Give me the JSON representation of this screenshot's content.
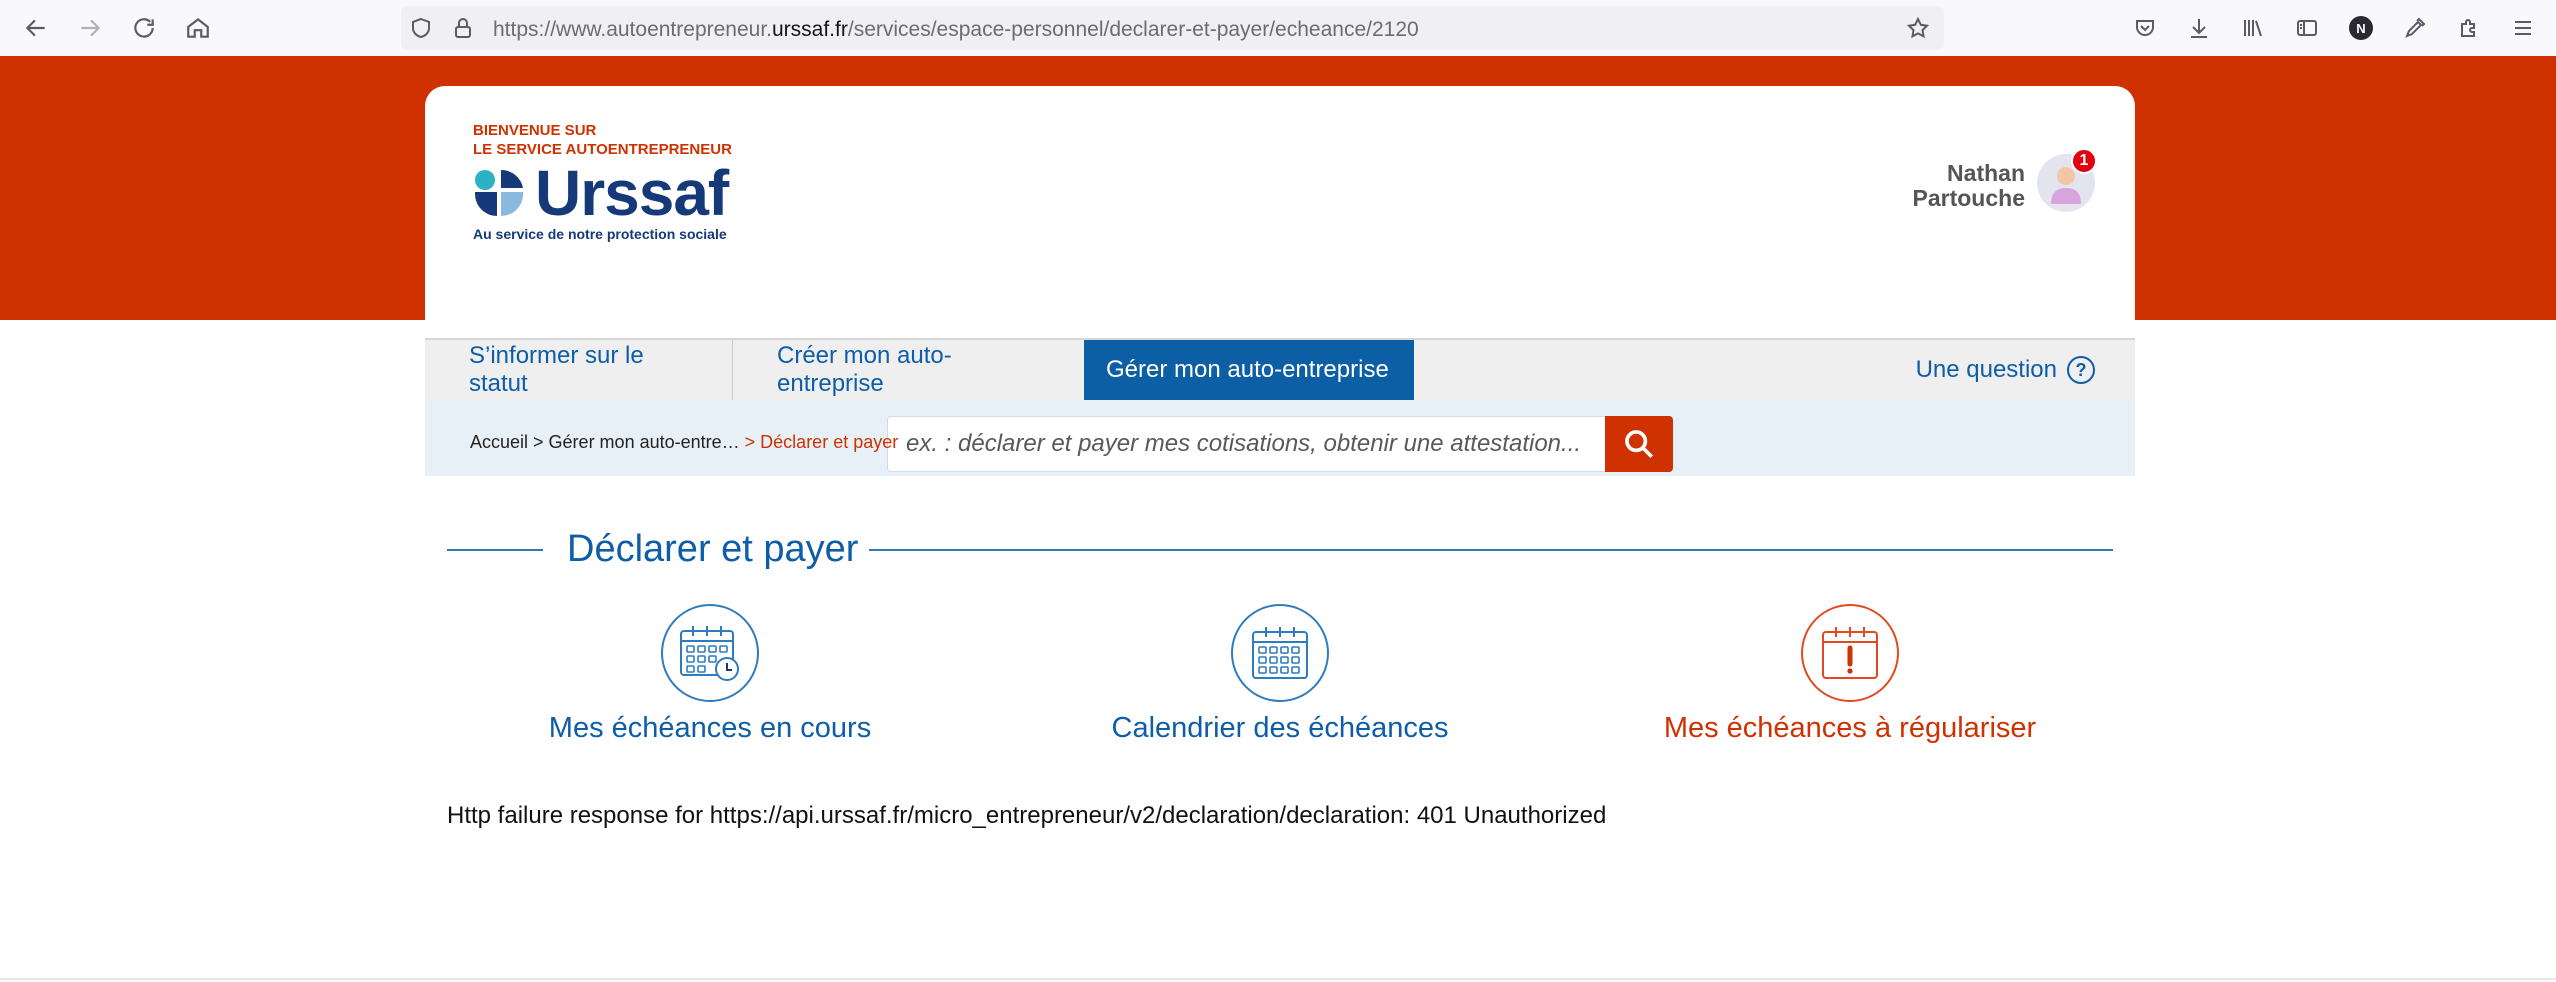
{
  "browser": {
    "url_prefix": "https://www.autoentrepreneur.",
    "url_domain": "urssaf.fr",
    "url_path": "/services/espace-personnel/declarer-et-payer/echeance/2120",
    "profile_initial": "N"
  },
  "header": {
    "welcome_line1": "BIENVENUE SUR",
    "welcome_line2": "LE SERVICE AUTOENTREPRENEUR",
    "logo_text": "Urssaf",
    "logo_tagline": "Au service de notre protection sociale",
    "user_first": "Nathan",
    "user_last": "Partouche",
    "notification_count": "1"
  },
  "menu": {
    "items": [
      {
        "label": "S’informer sur le statut"
      },
      {
        "label": "Créer mon auto-entreprise"
      },
      {
        "label": "Gérer mon auto-entreprise"
      }
    ],
    "question_label": "Une question",
    "question_icon": "?"
  },
  "search": {
    "placeholder": "ex. : déclarer et payer mes cotisations, obtenir une attestation..."
  },
  "breadcrumb": {
    "home": "Accueil",
    "sep1": " > ",
    "parent": "Gérer mon auto-entre…",
    "current": " > Déclarer et payer"
  },
  "section": {
    "title": "Déclarer et payer"
  },
  "tiles": [
    {
      "label": "Mes échéances en cours",
      "icon": "calendar-clock-icon"
    },
    {
      "label": "Calendrier des échéances",
      "icon": "calendar-icon"
    },
    {
      "label": "Mes échéances à régulariser",
      "icon": "calendar-alert-icon"
    }
  ],
  "error": {
    "message": "Http failure response for https://api.urssaf.fr/micro_entrepreneur/v2/declaration/declaration: 401 Unauthorized"
  },
  "colors": {
    "brand_red": "#cf3100",
    "brand_blue": "#0e5da8",
    "active_menu": "#0c5ea5"
  }
}
